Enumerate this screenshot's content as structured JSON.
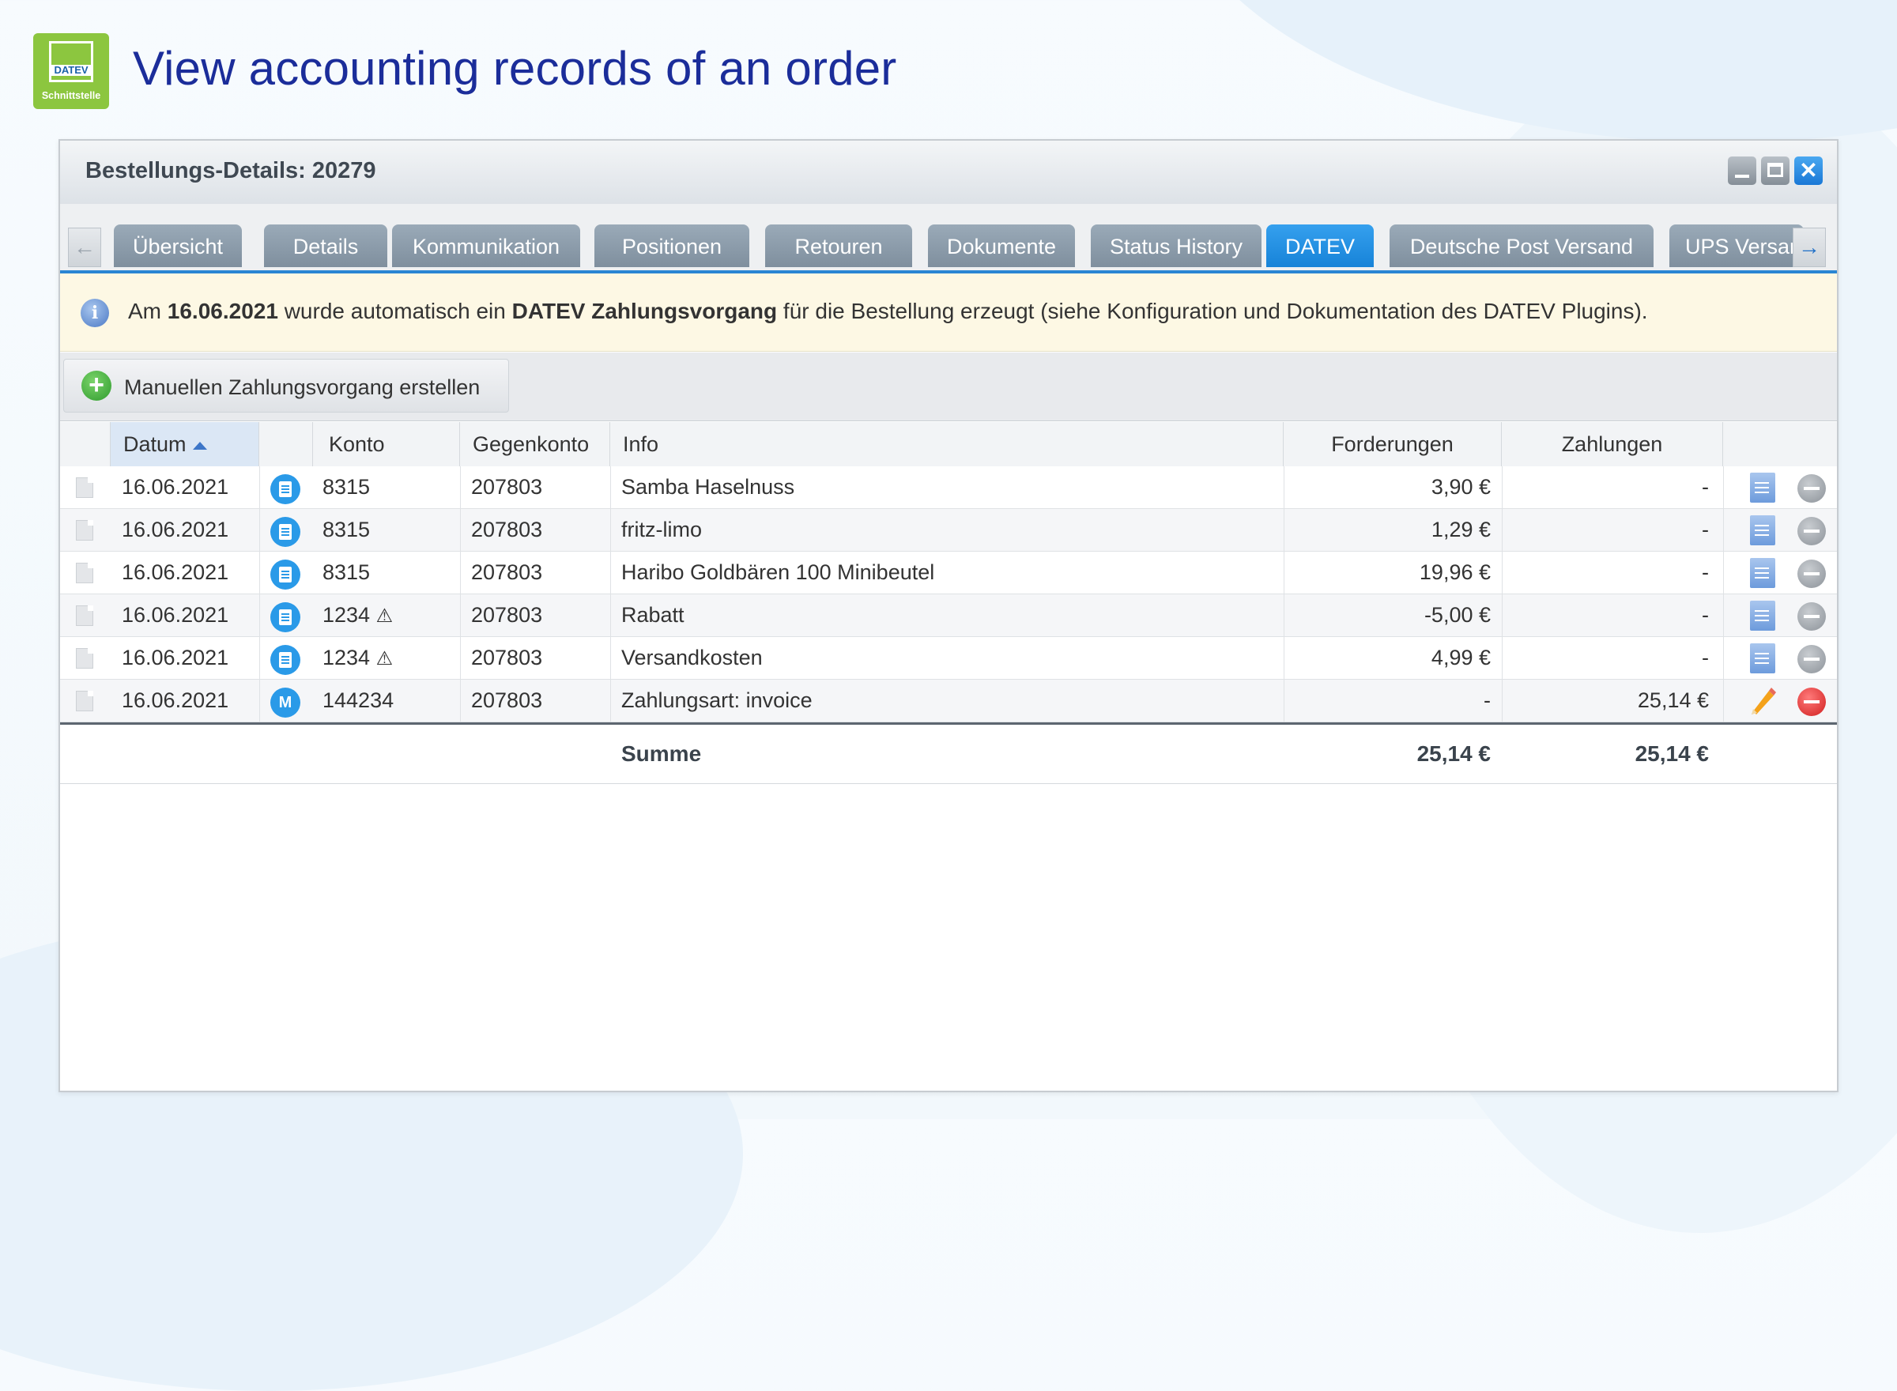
{
  "header": {
    "logo_text": "DATEV",
    "logo_subtext": "Schnittstelle",
    "title": "View accounting records of an order"
  },
  "window": {
    "title": "Bestellungs-Details: 20279",
    "close_glyph": "✕"
  },
  "tabs": [
    {
      "label": "Übersicht",
      "active": false
    },
    {
      "label": "Details",
      "active": false
    },
    {
      "label": "Kommunikation",
      "active": false
    },
    {
      "label": "Positionen",
      "active": false
    },
    {
      "label": "Retouren",
      "active": false
    },
    {
      "label": "Dokumente",
      "active": false
    },
    {
      "label": "Status History",
      "active": false
    },
    {
      "label": "DATEV",
      "active": true
    },
    {
      "label": "Deutsche Post Versand",
      "active": false
    },
    {
      "label": "UPS Versand",
      "active": false
    }
  ],
  "info": {
    "part1": "Am ",
    "date": "16.06.2021",
    "part2": " wurde automatisch ein ",
    "highlight": "DATEV Zahlungsvorgang",
    "part3": " für die Bestellung erzeugt (siehe Konfiguration und Dokumentation des DATEV Plugins)."
  },
  "toolbar": {
    "add_label": "Manuellen Zahlungsvorgang erstellen"
  },
  "table": {
    "columns": {
      "datum": "Datum",
      "konto": "Konto",
      "gegenkonto": "Gegenkonto",
      "info": "Info",
      "forderungen": "Forderungen",
      "zahlungen": "Zahlungen"
    },
    "rows": [
      {
        "datum": "16.06.2021",
        "type": "list",
        "badge": "",
        "konto": "8315",
        "warn": "",
        "gegenkonto": "207803",
        "info": "Samba Haselnuss",
        "forderungen": "3,90 €",
        "zahlungen": "-",
        "action": "doc",
        "remove_enabled": false
      },
      {
        "datum": "16.06.2021",
        "type": "list",
        "badge": "",
        "konto": "8315",
        "warn": "",
        "gegenkonto": "207803",
        "info": "fritz-limo",
        "forderungen": "1,29 €",
        "zahlungen": "-",
        "action": "doc",
        "remove_enabled": false
      },
      {
        "datum": "16.06.2021",
        "type": "list",
        "badge": "",
        "konto": "8315",
        "warn": "",
        "gegenkonto": "207803",
        "info": "Haribo Goldbären 100 Minibeutel",
        "forderungen": "19,96 €",
        "zahlungen": "-",
        "action": "doc",
        "remove_enabled": false
      },
      {
        "datum": "16.06.2021",
        "type": "list",
        "badge": "",
        "konto": "1234",
        "warn": "⚠",
        "gegenkonto": "207803",
        "info": "Rabatt",
        "forderungen": "-5,00 €",
        "zahlungen": "-",
        "action": "doc",
        "remove_enabled": false
      },
      {
        "datum": "16.06.2021",
        "type": "list",
        "badge": "",
        "konto": "1234",
        "warn": "⚠",
        "gegenkonto": "207803",
        "info": "Versandkosten",
        "forderungen": "4,99 €",
        "zahlungen": "-",
        "action": "doc",
        "remove_enabled": false
      },
      {
        "datum": "16.06.2021",
        "type": "manual",
        "badge": "M",
        "konto": "144234",
        "warn": "",
        "gegenkonto": "207803",
        "info": "Zahlungsart: invoice",
        "forderungen": "-",
        "zahlungen": "25,14 €",
        "action": "edit",
        "remove_enabled": true
      }
    ],
    "summary": {
      "label": "Summe",
      "forderungen": "25,14 €",
      "zahlungen": "25,14 €"
    }
  },
  "colors": {
    "accent": "#2a86d3",
    "title": "#1b2d9a",
    "logo": "#8cc63f"
  }
}
